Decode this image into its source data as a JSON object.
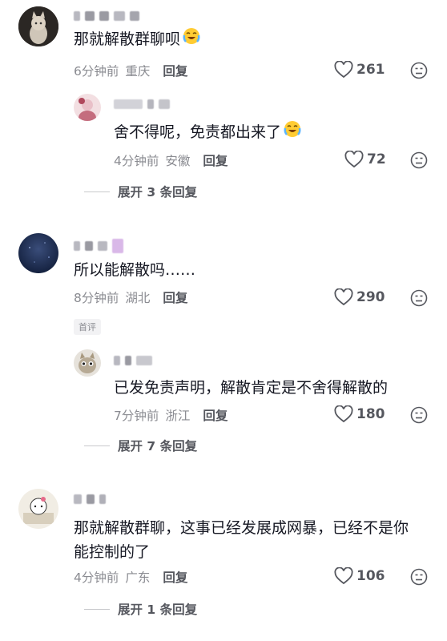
{
  "comments": [
    {
      "text": "那就解散群聊呗",
      "time": "6分钟前",
      "location": "重庆",
      "reply_label": "回复",
      "likes": "261",
      "emoji": "crying-laughing-emoji",
      "reply": {
        "text": "舍不得呢，免责都出来了",
        "time": "4分钟前",
        "location": "安徽",
        "reply_label": "回复",
        "likes": "72",
        "emoji": "crying-laughing-emoji"
      },
      "expand_label": "展开 3 条回复"
    },
    {
      "text": "所以能解散吗……",
      "time": "8分钟前",
      "location": "湖北",
      "reply_label": "回复",
      "likes": "290",
      "badge": "首评",
      "reply": {
        "text": "已发免责声明，解散肯定是不舍得解散的",
        "time": "7分钟前",
        "location": "浙江",
        "reply_label": "回复",
        "likes": "180"
      },
      "expand_label": "展开 7 条回复"
    },
    {
      "text_line1": "那就解散群聊，这事已经发展成网暴，已经不是你",
      "text_line2": "能控制的了",
      "time": "4分钟前",
      "location": "广东",
      "reply_label": "回复",
      "likes": "106",
      "expand_label": "展开 1 条回复"
    }
  ],
  "colors": {
    "text_primary": "#161823",
    "text_secondary": "#8a8b91",
    "action_text": "#55575e"
  },
  "icons": [
    "heart-outline-icon",
    "dislike-face-icon",
    "crying-laughing-emoji"
  ]
}
